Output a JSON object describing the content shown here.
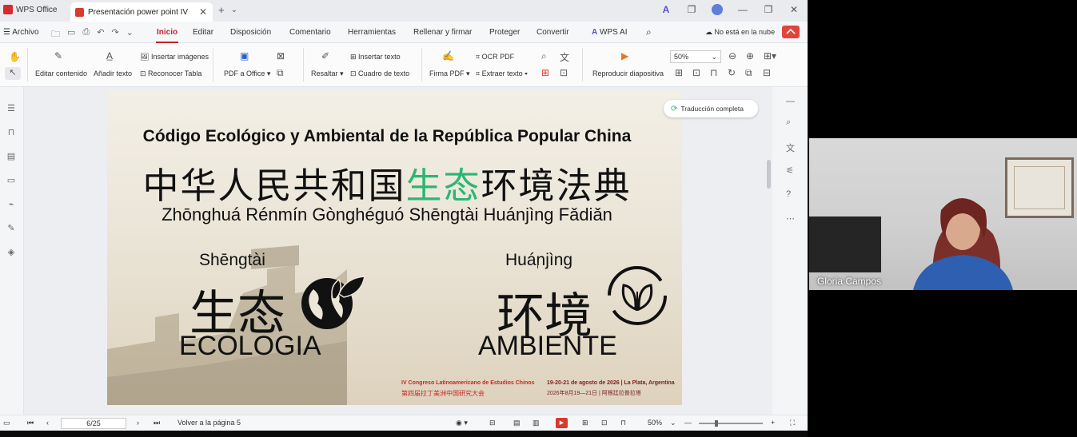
{
  "titlebar": {
    "app_name": "WPS Office",
    "tab_title": "Presentación power point IV",
    "new_tab": "+",
    "tab_menu": "⌄"
  },
  "menubar": {
    "file": "Archivo",
    "items": [
      "Inicio",
      "Editar",
      "Disposición",
      "Comentario",
      "Herramientas",
      "Rellenar y firmar",
      "Proteger",
      "Convertir"
    ],
    "wps_ai": "WPS AI",
    "cloud_status": "No está en la nube"
  },
  "ribbon": {
    "edit_content": "Editar contenido",
    "add_text": "Añadir texto",
    "insert_images": "Insertar imágenes",
    "recognize_table": "Reconocer Tabla",
    "pdf_to_office": "PDF a Office",
    "highlight": "Resaltar",
    "insert_text": "Insertar texto",
    "text_box": "Cuadro de texto",
    "sign_pdf": "Firma PDF",
    "ocr_pdf": "OCR PDF",
    "extract_text": "Extraer texto",
    "play_slideshow": "Reproducir diapositiva",
    "zoom_value": "50%"
  },
  "slide": {
    "title": "Código Ecológico y Ambiental de la República Popular China",
    "chinese_a": "中华人民共和国",
    "chinese_green": "生态",
    "chinese_b": "环境法典",
    "pinyin": "Zhōnghuá Rénmín Gònghéguó Shēngtài Huánjìng Fǎdiǎn",
    "left_pinyin": "Shēngtài",
    "left_chinese": "生态",
    "left_word": "ECOLOGIA",
    "right_pinyin": "Huánjìng",
    "right_chinese": "环境",
    "right_word": "AMBIENTE",
    "footer_left_1": "IV Congreso Latinoamericano de Estudios Chinos",
    "footer_left_2": "第四届拉丁美洲中国研究大会",
    "footer_right_1": "19-20-21 de agosto de 2026 | La Plata, Argentina",
    "footer_right_2": "2026年8月19—21日  |  阿根廷拉普拉塔"
  },
  "translate_button": "Traducción completa",
  "statusbar": {
    "page": "6/25",
    "back_to_page": "Volver a la página 5",
    "zoom": "50%"
  },
  "video": {
    "participant_name": "Gloria Campos"
  },
  "colors": {
    "accent": "#c3242a",
    "chinese_green": "#2bb673",
    "footer_red": "#c62828"
  }
}
